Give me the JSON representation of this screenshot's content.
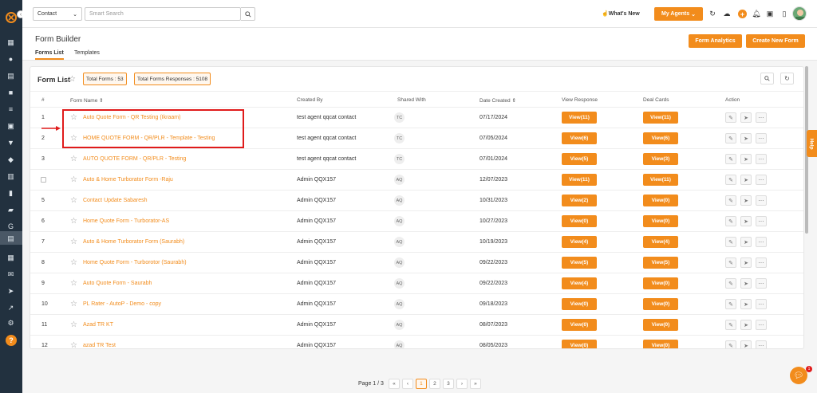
{
  "topbar": {
    "contact_select": "Contact",
    "search_placeholder": "Smart Search",
    "whats_new": "What's New",
    "my_agents": "My Agents"
  },
  "header": {
    "title": "Form Builder",
    "tabs": [
      {
        "label": "Forms List",
        "active": true
      },
      {
        "label": "Templates",
        "active": false
      }
    ],
    "form_analytics": "Form Analytics",
    "create_new_form": "Create New Form"
  },
  "card": {
    "title": "Form List",
    "total_forms": "Total Forms : 53",
    "total_responses": "Total Forms Responses : 5108"
  },
  "table": {
    "columns": {
      "num": "#",
      "form_name": "Form Name",
      "created_by": "Created By",
      "shared_with": "Shared With",
      "date_created": "Date Created",
      "view_response": "View Response",
      "deal_cards": "Deal Cards",
      "action": "Action"
    },
    "rows": [
      {
        "num": "1",
        "name": "Auto Quote Form - QR Testing (Ikraam)",
        "created_by": "test agent qqcat contact",
        "shared": "TC",
        "date": "07/17/2024",
        "view": "View(11)",
        "deal": "View(11)"
      },
      {
        "num": "2",
        "name": "HOME QUOTE FORM - QR/PLR - Template - Testing",
        "created_by": "test agent qqcat contact",
        "shared": "TC",
        "date": "07/05/2024",
        "view": "View(6)",
        "deal": "View(6)"
      },
      {
        "num": "3",
        "name": "AUTO QUOTE FORM - QR/PLR - Testing",
        "created_by": "test agent qqcat contact",
        "shared": "TC",
        "date": "07/01/2024",
        "view": "View(5)",
        "deal": "View(3)"
      },
      {
        "num": "",
        "name": "Auto & Home Turborator Form -Raju",
        "created_by": "Admin QQX157",
        "shared": "AQ",
        "date": "12/07/2023",
        "view": "View(11)",
        "deal": "View(11)"
      },
      {
        "num": "5",
        "name": "Contact Update Sabaresh",
        "created_by": "Admin QQX157",
        "shared": "AQ",
        "date": "10/31/2023",
        "view": "View(2)",
        "deal": "View(0)"
      },
      {
        "num": "6",
        "name": "Home Quote Form - Turborator-AS",
        "created_by": "Admin QQX157",
        "shared": "AQ",
        "date": "10/27/2023",
        "view": "View(0)",
        "deal": "View(0)"
      },
      {
        "num": "7",
        "name": "Auto & Home Turborator Form (Saurabh)",
        "created_by": "Admin QQX157",
        "shared": "AQ",
        "date": "10/19/2023",
        "view": "View(4)",
        "deal": "View(4)"
      },
      {
        "num": "8",
        "name": "Home Quote Form - Turborotor (Saurabh)",
        "created_by": "Admin QQX157",
        "shared": "AQ",
        "date": "09/22/2023",
        "view": "View(5)",
        "deal": "View(5)"
      },
      {
        "num": "9",
        "name": "Auto Quote Form - Saurabh",
        "created_by": "Admin QQX157",
        "shared": "AQ",
        "date": "09/22/2023",
        "view": "View(4)",
        "deal": "View(0)"
      },
      {
        "num": "10",
        "name": "PL Rater - AutoP - Demo - copy",
        "created_by": "Admin QQX157",
        "shared": "AQ",
        "date": "09/18/2023",
        "view": "View(0)",
        "deal": "View(0)"
      },
      {
        "num": "11",
        "name": "Azad TR KT",
        "created_by": "Admin QQX157",
        "shared": "AQ",
        "date": "08/07/2023",
        "view": "View(0)",
        "deal": "View(0)"
      },
      {
        "num": "12",
        "name": "azad TR Test",
        "created_by": "Admin QQX157",
        "shared": "AQ",
        "date": "08/05/2023",
        "view": "View(0)",
        "deal": "View(0)"
      }
    ]
  },
  "pagination": {
    "label": "Page 1 / 3",
    "pages": [
      "1",
      "2",
      "3"
    ]
  },
  "help_tab": "Help",
  "chat_badge": "1",
  "colors": {
    "accent": "#f28c1c",
    "sidebar": "#22313f",
    "highlight": "#e01b1b"
  }
}
